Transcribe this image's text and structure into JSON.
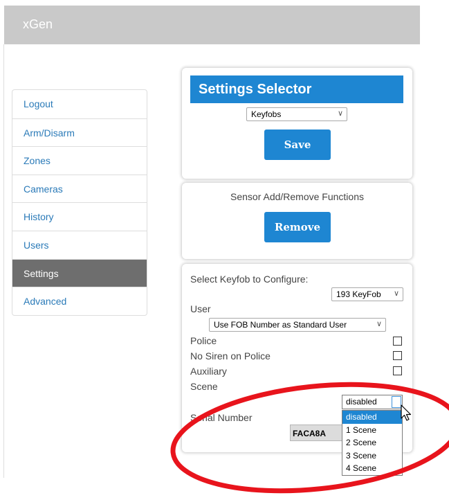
{
  "app": {
    "brand": "xGen"
  },
  "sidebar": {
    "items": [
      {
        "label": "Logout",
        "active": false
      },
      {
        "label": "Arm/Disarm",
        "active": false
      },
      {
        "label": "Zones",
        "active": false
      },
      {
        "label": "Cameras",
        "active": false
      },
      {
        "label": "History",
        "active": false
      },
      {
        "label": "Users",
        "active": false
      },
      {
        "label": "Settings",
        "active": true
      },
      {
        "label": "Advanced",
        "active": false
      }
    ]
  },
  "settings_selector": {
    "title": "Settings Selector",
    "selected": "Keyfobs",
    "save_label": "Save"
  },
  "sensor": {
    "title": "Sensor Add/Remove Functions",
    "remove_label": "Remove"
  },
  "keyfob": {
    "select_label": "Select Keyfob to Configure:",
    "selected_keyfob": "193 KeyFob",
    "user_label": "User",
    "user_value": "Use FOB Number as Standard User",
    "police_label": "Police",
    "no_siren_label": "No Siren on Police",
    "auxiliary_label": "Auxiliary",
    "scene_label": "Scene",
    "scene_value": "disabled",
    "scene_options": [
      "disabled",
      "1 Scene",
      "2 Scene",
      "3 Scene",
      "4 Scene"
    ],
    "scene_selected_index": 0,
    "serial_label": "Serial Number",
    "serial_value": "FACA8A"
  },
  "colors": {
    "accent": "#1e86d2",
    "active_nav": "#6e6e6e",
    "link": "#2a7ab8",
    "annotation": "#e8141c"
  }
}
